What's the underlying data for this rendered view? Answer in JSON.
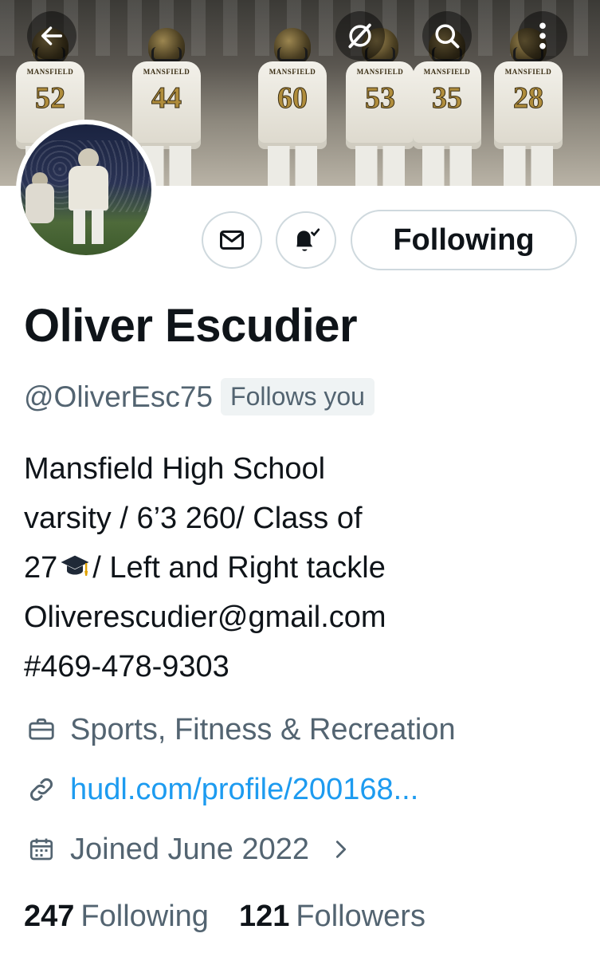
{
  "profile": {
    "display_name": "Oliver Escudier",
    "handle": "@OliverEsc75",
    "follows_you_badge": "Follows you",
    "bio_lines": [
      "Mansfield High School",
      "varsity / 6’3 260/ Class of",
      "27",
      "/ Left and Right tackle",
      "Oliverescudier@gmail.com",
      "#469-478-9303"
    ],
    "category": "Sports, Fitness & Recreation",
    "link": "hudl.com/profile/200168...",
    "joined": "Joined June 2022"
  },
  "actions": {
    "following_label": "Following"
  },
  "stats": {
    "following_count": "247",
    "following_label": "Following",
    "followers_count": "121",
    "followers_label": "Followers"
  },
  "banner": {
    "jersey_text": "MANSFIELD",
    "jersey_numbers": [
      "52",
      "44",
      "60",
      "53",
      "35",
      "28"
    ]
  },
  "colors": {
    "primary_text": "#0f1419",
    "secondary_text": "#536471",
    "link": "#1d9bf0",
    "border": "#cfd9de",
    "jersey_gold": "#b08d3c"
  },
  "icons": {
    "back": "arrow-left-icon",
    "grok": "slash-circle-icon",
    "search": "search-icon",
    "more": "more-vertical-icon",
    "message": "envelope-icon",
    "notifications": "bell-check-icon",
    "category": "briefcase-icon",
    "link": "link-icon",
    "joined": "calendar-icon",
    "chevron": "chevron-right-icon",
    "graduation": "graduation-cap-icon"
  }
}
